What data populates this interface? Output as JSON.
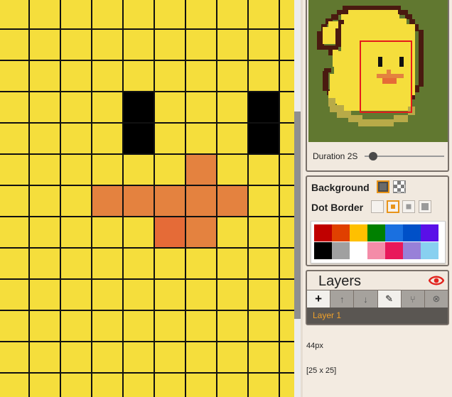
{
  "canvas": {
    "cell_colors": {
      "base": "#f5de3c",
      "black": "#000000",
      "orange": "#e4823f",
      "dark_orange": "#e56b37"
    },
    "pixels": [
      {
        "col": 4,
        "row": 3,
        "color": "black"
      },
      {
        "col": 8,
        "row": 3,
        "color": "black"
      },
      {
        "col": 4,
        "row": 4,
        "color": "black"
      },
      {
        "col": 8,
        "row": 4,
        "color": "black"
      },
      {
        "col": 6,
        "row": 5,
        "color": "orange"
      },
      {
        "col": 3,
        "row": 6,
        "color": "orange"
      },
      {
        "col": 4,
        "row": 6,
        "color": "orange"
      },
      {
        "col": 5,
        "row": 6,
        "color": "orange"
      },
      {
        "col": 6,
        "row": 6,
        "color": "orange"
      },
      {
        "col": 7,
        "row": 6,
        "color": "orange"
      },
      {
        "col": 5,
        "row": 7,
        "color": "dark_orange"
      },
      {
        "col": 6,
        "row": 7,
        "color": "orange"
      }
    ]
  },
  "preview": {
    "background_color": "#617830",
    "duration_label": "Duration 2S",
    "duration_value": 0.05
  },
  "settings": {
    "background_label": "Background",
    "dot_border_label": "Dot Border",
    "palette": [
      "#c00000",
      "#e04000",
      "#ffc000",
      "#008000",
      "#1a70e0",
      "#0050c8",
      "#5a10e8",
      "#000000",
      "#a0a0a0",
      "#ffffff",
      "#f48ca8",
      "#e8185a",
      "#9880d8",
      "#88d0f0"
    ]
  },
  "layers": {
    "title": "Layers",
    "toolbar": [
      "+",
      "↑",
      "↓",
      "✎",
      "⑂",
      "⊗"
    ],
    "items": [
      "Layer 1"
    ]
  },
  "info": {
    "cell_size": "44px",
    "grid_size": "[25 x 25]"
  }
}
